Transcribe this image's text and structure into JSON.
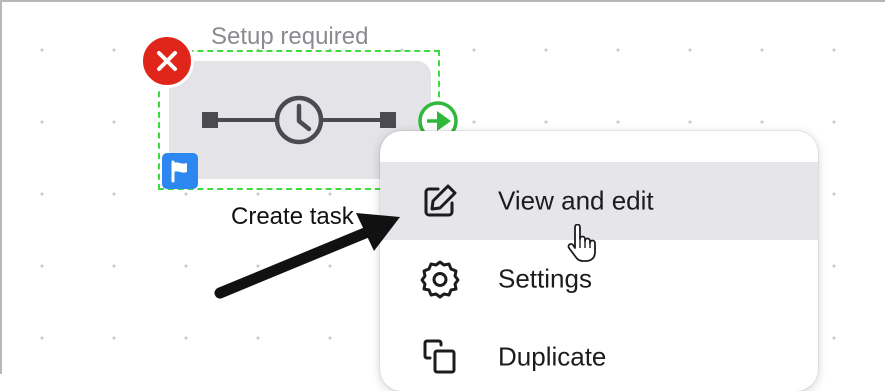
{
  "canvas": {
    "node": {
      "status_label": "Setup required",
      "label": "Create task",
      "icons": {
        "error": "close-x-icon",
        "flag": "flag-icon",
        "timer": "clock-icon",
        "connector": "arrow-right-circle-icon"
      }
    }
  },
  "context_menu": {
    "items": [
      {
        "label": "View and edit",
        "icon": "edit-icon",
        "state": "hover"
      },
      {
        "label": "Settings",
        "icon": "gear-icon"
      },
      {
        "label": "Duplicate",
        "icon": "duplicate-icon"
      }
    ]
  },
  "colors": {
    "error_red": "#e0261b",
    "selection_green": "#3ddc3d",
    "flag_blue": "#2d87f0",
    "connector_green": "#2fb83a",
    "node_gray": "#e4e4e8",
    "hover_gray": "#e6e6ea"
  }
}
